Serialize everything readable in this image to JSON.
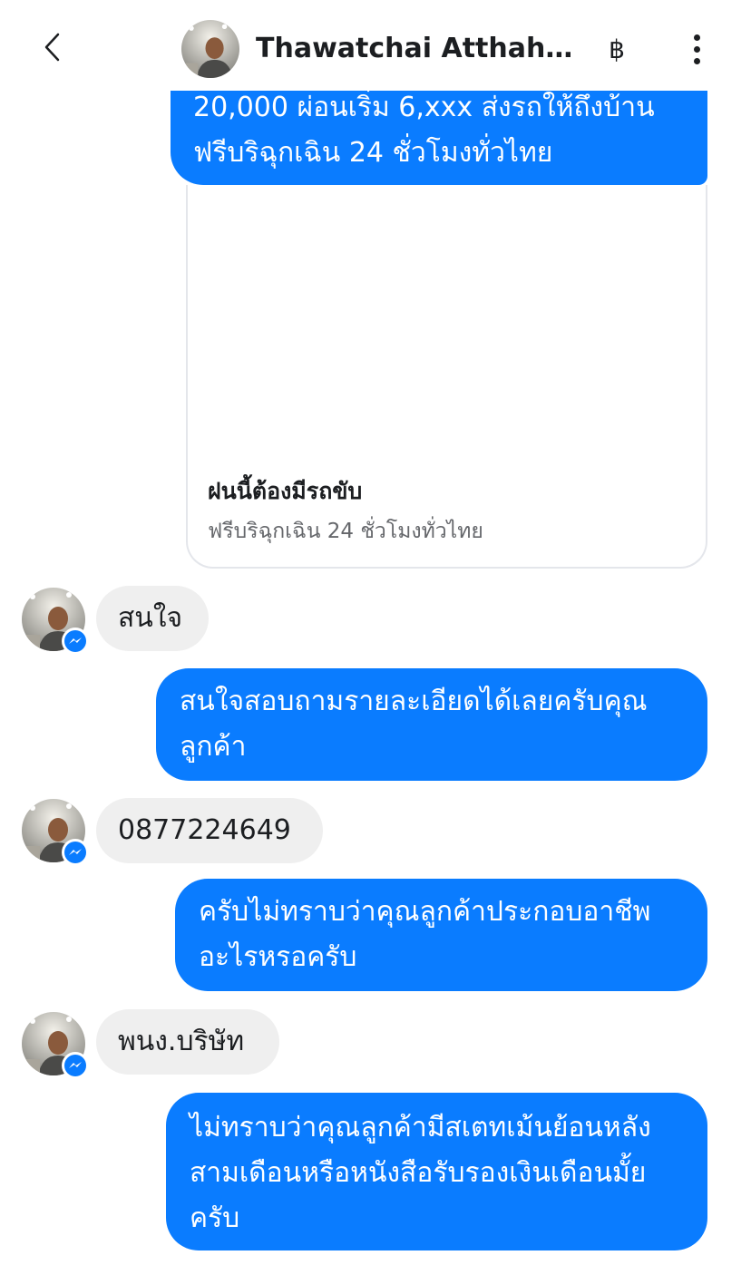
{
  "header": {
    "contact_name": "Thawatchai Atthah...",
    "currency_symbol": "฿",
    "back_icon": "chevron-left-icon",
    "more_icon": "vertical-dots-icon"
  },
  "messages": {
    "outgoing_top": "20,000  ผ่อนเริ่ม 6,xxx ส่งรถให้ถึงบ้าน ฟรีบริฉุกเฉิน 24 ชั่วโมงทั่วไทย",
    "link_card": {
      "title": "ฝนนี้ต้องมีรถขับ",
      "subtitle": "ฟรีบริฉุกเฉิน 24 ชั่วโมงทั่วไทย"
    },
    "incoming_1": "สนใจ",
    "outgoing_2": "สนใจสอบถามรายละเอียดได้เลยครับคุณลูกค้า",
    "incoming_2": "0877224649",
    "outgoing_3": "ครับไม่ทราบว่าคุณลูกค้าประกอบอาชีพอะไรหรอครับ",
    "incoming_3": "พนง.บริษัท",
    "outgoing_4": "ไม่ทราบว่าคุณลูกค้ามีสเตทเม้นย้อนหลังสามเดือนหรือหนังสือรับรองเงินเดือนมั้ยครับ"
  },
  "colors": {
    "outgoing_bubble": "#0a7cff",
    "incoming_bubble": "#efefef",
    "badge": "#0a7cff"
  }
}
